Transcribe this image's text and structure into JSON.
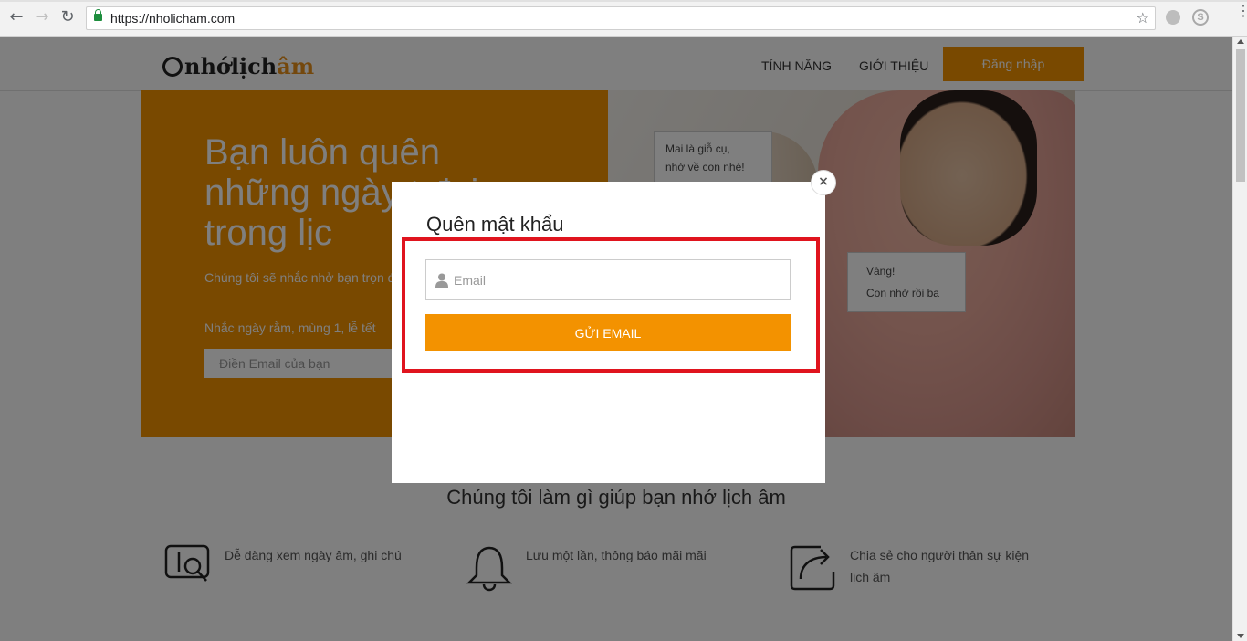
{
  "browser": {
    "url": "https://nholicham.com",
    "back_icon": "←",
    "forward_icon": "→",
    "reload_icon": "↻",
    "star_icon": "☆",
    "skype_icon": "S",
    "menu_icon": "⋮"
  },
  "header": {
    "logo_main": "nhớlịch",
    "logo_accent": "âm",
    "nav": [
      "TÍNH NĂNG",
      "GIỚI THIỆU"
    ],
    "login_label": "Đăng nhập"
  },
  "hero": {
    "title": "Bạn luôn quên những ngày t đại trong lịc",
    "subtitle": "Chúng tôi sẽ nhắc nhở bạn trọn đờ",
    "subtitle2": "Nhắc ngày rằm, mùng 1, lễ tết",
    "email_placeholder": "Điền Email của bạn",
    "bubble1_line1": "Mai là giỗ cụ,",
    "bubble1_line2": "nhớ về con nhé!",
    "bubble2_line1": "Vâng!",
    "bubble2_line2": "Con nhớ rồi ba"
  },
  "features": {
    "title": "Chúng tôi làm gì giúp bạn nhớ lịch âm",
    "items": [
      {
        "text": "Dễ dàng xem ngày âm, ghi chú",
        "icon": "calendar-search-icon"
      },
      {
        "text": "Lưu một lần, thông báo mãi mãi",
        "icon": "bell-icon"
      },
      {
        "text": "Chia sẻ cho người thân sự kiện lịch âm",
        "icon": "share-icon"
      }
    ]
  },
  "modal": {
    "title": "Quên mật khẩu",
    "close_icon": "×",
    "email_placeholder": "Email",
    "submit_label": "GỬI EMAIL"
  },
  "colors": {
    "accent": "#f39200",
    "highlight": "#e0141e"
  }
}
